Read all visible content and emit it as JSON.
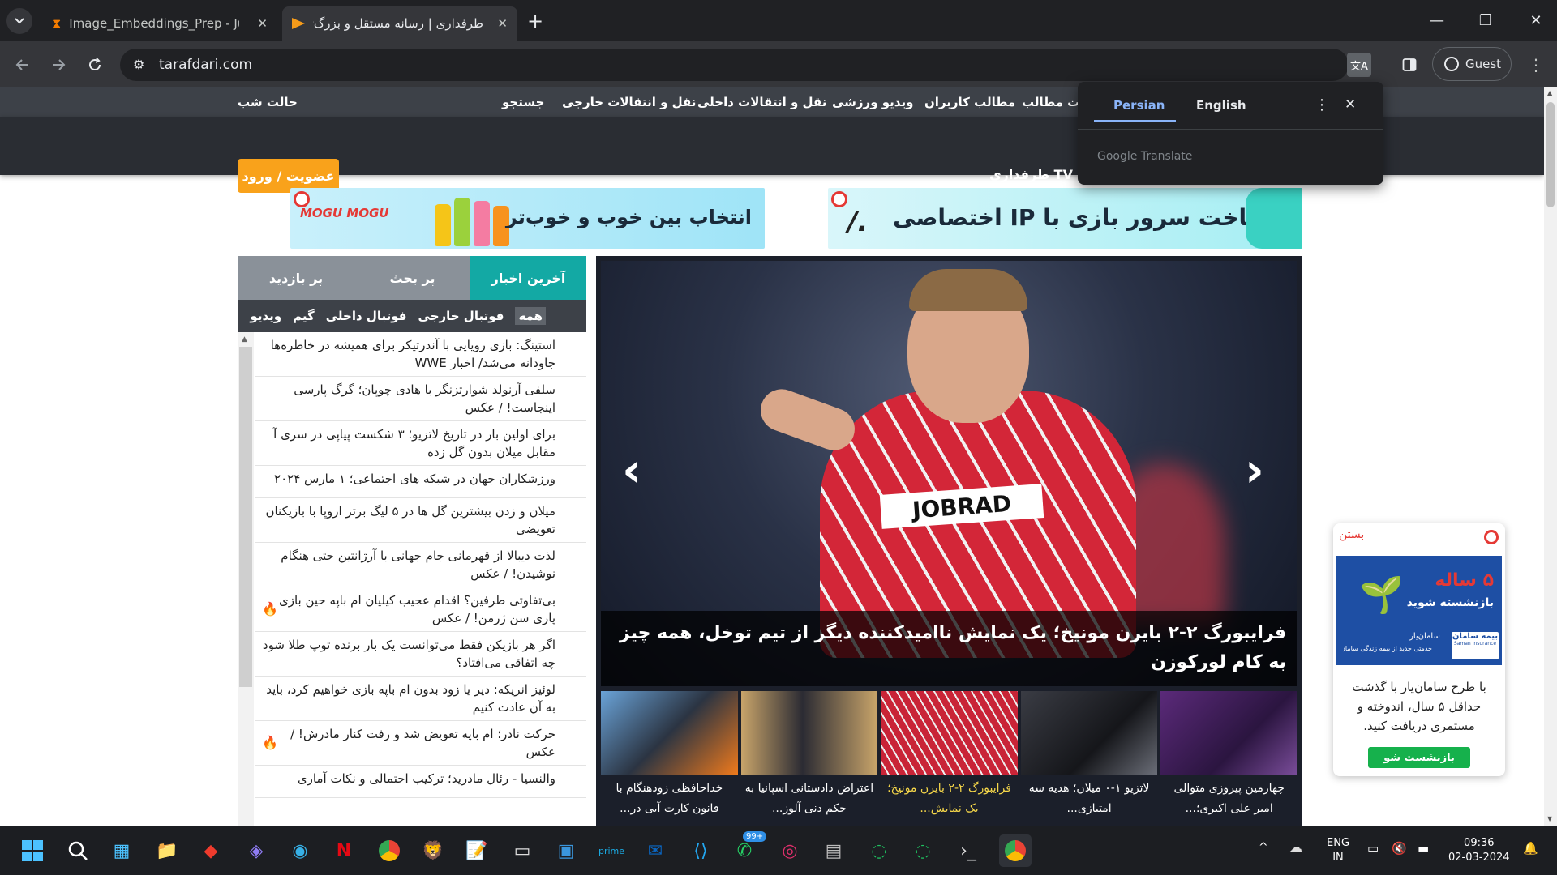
{
  "browser": {
    "tabs": [
      {
        "title": "Image_Embeddings_Prep - Jupy",
        "icon": "hourglass-icon"
      },
      {
        "title": "طرفداری | رسانه مستقل و بزرگ‌تر",
        "icon": "tarafdari-icon"
      }
    ],
    "url": "tarafdari.com",
    "guest_label": "Guest"
  },
  "site": {
    "topnav": {
      "night_mode": "حالت شب",
      "items": [
        "جستجو",
        "نقل و انتقالات خارجی",
        "نقل و انتقالات داخلی",
        "ویدیو ورزشی",
        "مطالب کاربران",
        "ت مطالب"
      ]
    },
    "subnav": {
      "login": "عضویت / ورود",
      "tv": "طرفداری TV"
    },
    "banners": {
      "mogu_brand": "MOGU MOGU",
      "mogu_text": "انتخاب بین خوب و خوب‌تر",
      "server_text": "ساخت سرور بازی با IP اختصاصی"
    },
    "news_tabs": [
      "آخرین اخبار",
      "پر بحث",
      "پر بازدید"
    ],
    "news_filters": [
      "همه",
      "فوتبال خارجی",
      "فوتبال داخلی",
      "گیم",
      "ویدیو"
    ],
    "news_items": [
      {
        "text": "استینگ: بازی رویایی با آندرتیکر برای همیشه در خاطره‌ها جاودانه می‌شد/ اخبار WWE",
        "hot": false
      },
      {
        "text": "سلفی آرنولد شوارتزنگر با هادی چوپان؛ گرگ پارسی اینجاست! / عکس",
        "hot": false
      },
      {
        "text": "برای اولین بار در تاریخ لاتزیو؛ ۳ شکست پیاپی در سری آ مقابل میلان بدون گل زده",
        "hot": false
      },
      {
        "text": "ورزشکاران جهان در شبکه های اجتماعی؛ ۱ مارس ۲۰۲۴",
        "hot": false
      },
      {
        "text": "میلان و زدن بیشترین گل ها در ۵ لیگ برتر اروپا با بازیکنان تعویضی",
        "hot": false
      },
      {
        "text": "لذت دیبالا از قهرمانی جام جهانی با آرژانتین حتی هنگام نوشیدن! / عکس",
        "hot": false
      },
      {
        "text": "بی‌تفاوتی طرفین؟ اقدام عجیب کیلیان ام باپه حین بازی پاری سن ژرمن! / عکس",
        "hot": true
      },
      {
        "text": "اگر هر بازیکن فقط می‌توانست یک بار برنده توپ طلا شود چه اتفاقی می‌افتاد؟",
        "hot": false
      },
      {
        "text": "لوئیز انریکه: دیر یا زود بدون ام باپه بازی خواهیم کرد، باید به آن عادت کنیم",
        "hot": false
      },
      {
        "text": "حرکت نادر؛ ام باپه تعویض شد و رفت کنار مادرش! / عکس",
        "hot": true
      },
      {
        "text": "والنسیا - رئال مادرید؛ ترکیب احتمالی و نکات آماری",
        "hot": false
      }
    ],
    "hero": {
      "caption": "فرایبورگ ۲-۲ بایرن مونیخ؛ یک نمایش ناامیدکننده دیگر از تیم توخل، همه چیز به کام لورکوزن",
      "shirt_text": "JOBRAD"
    },
    "thumbs": [
      {
        "caption": "چهارمین پیروزی متوالی امیر علی اکبری؛...",
        "active": false
      },
      {
        "caption": "لاتزیو ۱-۰ میلان؛ هدیه سه امتیازی...",
        "active": false
      },
      {
        "caption": "فرایبورگ ۲-۲ بایرن مونیخ؛ یک نمایش...",
        "active": true
      },
      {
        "caption": "اعتراض دادستانی اسپانیا به حکم دنی آلوز...",
        "active": false
      },
      {
        "caption": "خداحافظی زودهنگام با قانون کارت آبی در...",
        "active": false
      }
    ],
    "side_ad": {
      "close": "بستن",
      "headline": "۵ ساله",
      "subheadline": "بازنشسته شوید",
      "brand": "سامان‌یار",
      "brand_sub": "خدمتی جدید از بیمه زندگی سامان",
      "insurer": "بیمه سامان",
      "insurer_en": "Saman Insurance",
      "body": "با طرح سامان‌یار با گذشت حداقل ۵ سال، اندوخته و مستمری دریافت کنید.",
      "button": "بازنشست شو"
    }
  },
  "translate_popup": {
    "tabs": [
      "Persian",
      "English"
    ],
    "footer": "Google Translate"
  },
  "taskbar": {
    "lang_line1": "ENG",
    "lang_line2": "IN",
    "time": "09:36",
    "date": "02-03-2024",
    "badge": "99+"
  }
}
